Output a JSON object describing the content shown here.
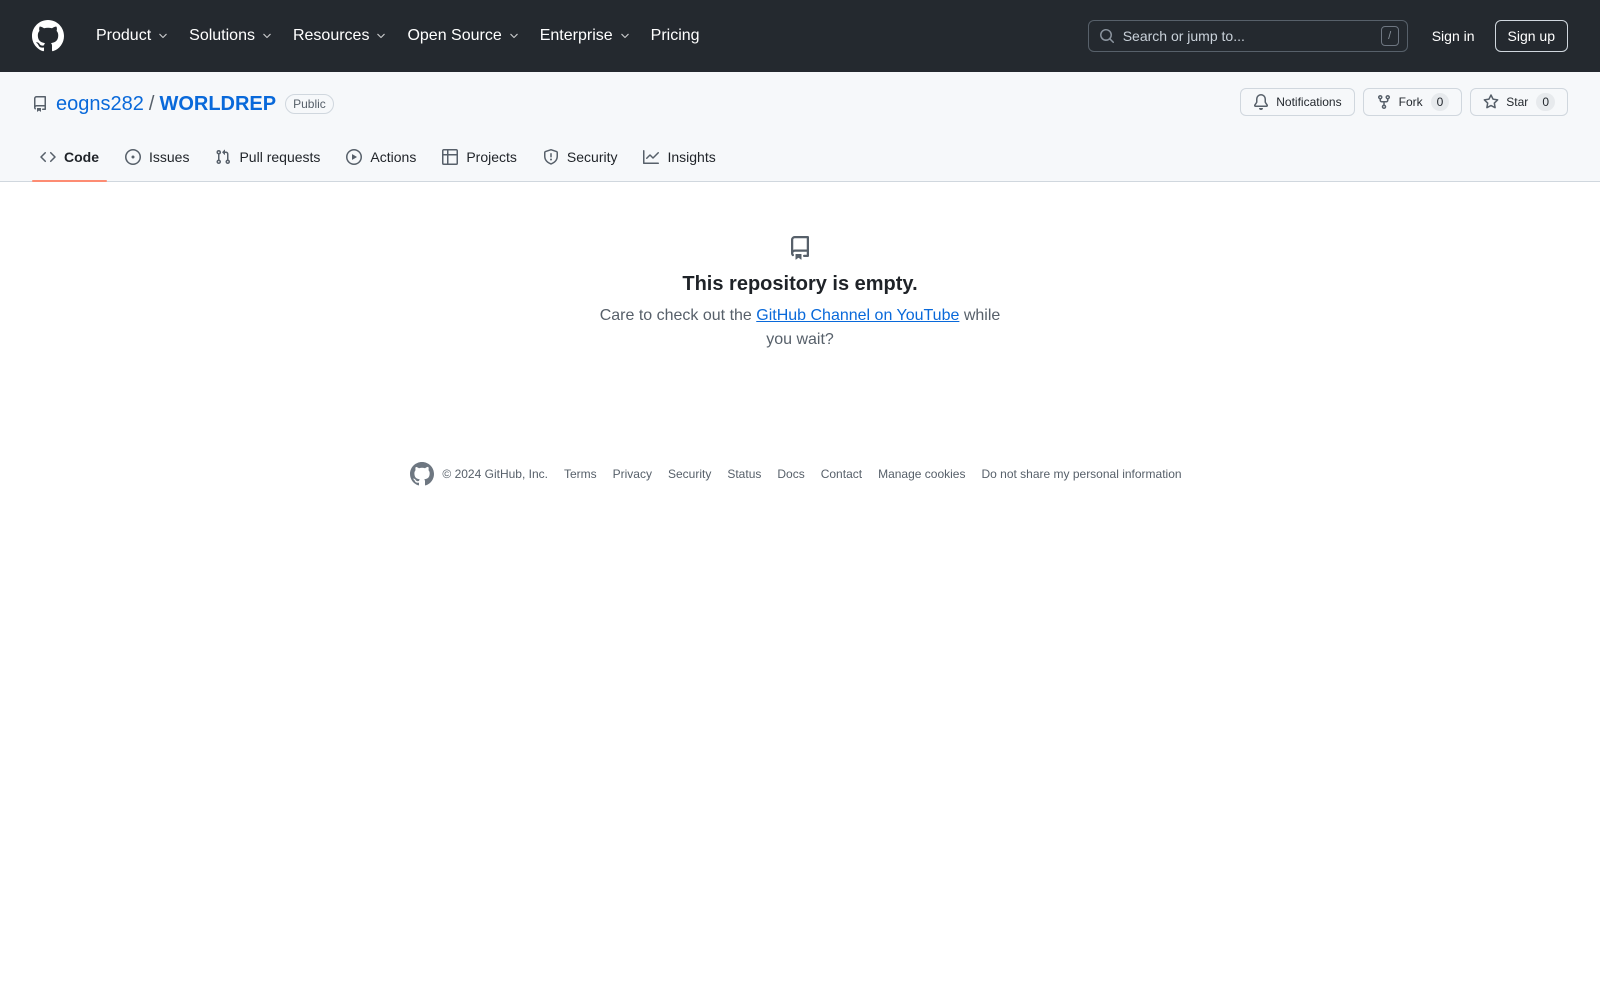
{
  "header": {
    "nav": [
      {
        "label": "Product",
        "dropdown": true
      },
      {
        "label": "Solutions",
        "dropdown": true
      },
      {
        "label": "Resources",
        "dropdown": true
      },
      {
        "label": "Open Source",
        "dropdown": true
      },
      {
        "label": "Enterprise",
        "dropdown": true
      },
      {
        "label": "Pricing",
        "dropdown": false
      }
    ],
    "search_placeholder": "Search or jump to...",
    "search_shortcut": "/",
    "signin_label": "Sign in",
    "signup_label": "Sign up"
  },
  "repo": {
    "owner": "eogns282",
    "separator": "/",
    "name": "WORLDREP",
    "visibility": "Public",
    "notifications_label": "Notifications",
    "fork_label": "Fork",
    "fork_count": "0",
    "star_label": "Star",
    "star_count": "0"
  },
  "tabs": [
    {
      "label": "Code",
      "icon": "code-icon",
      "active": true
    },
    {
      "label": "Issues",
      "icon": "issue-opened-icon",
      "active": false
    },
    {
      "label": "Pull requests",
      "icon": "git-pull-request-icon",
      "active": false
    },
    {
      "label": "Actions",
      "icon": "play-icon",
      "active": false
    },
    {
      "label": "Projects",
      "icon": "table-icon",
      "active": false
    },
    {
      "label": "Security",
      "icon": "shield-icon",
      "active": false
    },
    {
      "label": "Insights",
      "icon": "graph-icon",
      "active": false
    }
  ],
  "empty": {
    "title": "This repository is empty.",
    "text_before": "Care to check out the ",
    "link": "GitHub Channel on YouTube",
    "text_after": " while you wait?"
  },
  "footer": {
    "copyright": "© 2024 GitHub, Inc.",
    "links": [
      "Terms",
      "Privacy",
      "Security",
      "Status",
      "Docs",
      "Contact",
      "Manage cookies",
      "Do not share my personal information"
    ]
  },
  "colors": {
    "header_bg": "#24292f",
    "link": "#0969da",
    "active_tab_underline": "#fd8c73"
  }
}
